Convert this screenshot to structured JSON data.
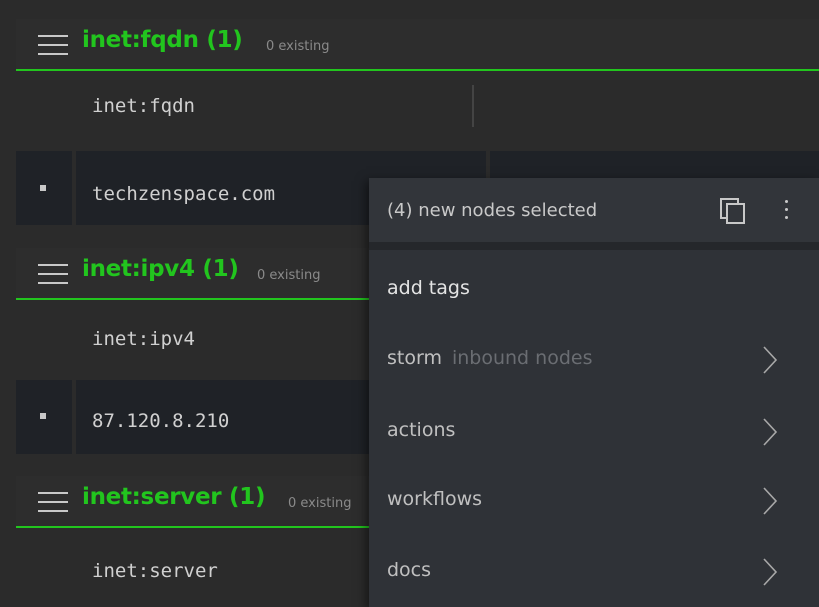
{
  "sections": [
    {
      "form": "inet:fqdn (1)",
      "existing": "0 existing",
      "column": "inet:fqdn",
      "value": "techzenspace.com"
    },
    {
      "form": "inet:ipv4 (1)",
      "existing": "0 existing",
      "column": "inet:ipv4",
      "value": "87.120.8.210"
    },
    {
      "form": "inet:server (1)",
      "existing": "0 existing",
      "column": "inet:server"
    }
  ],
  "menu": {
    "title": "(4) new nodes selected",
    "items": [
      {
        "label": "add tags"
      },
      {
        "label": "storm",
        "sub": "inbound nodes"
      },
      {
        "label": "actions"
      },
      {
        "label": "workflows"
      },
      {
        "label": "docs"
      }
    ]
  },
  "colors": {
    "accent": "#22c51e",
    "background": "#2b2b2b",
    "row": "#1f2227",
    "menu": "#2f3237"
  }
}
